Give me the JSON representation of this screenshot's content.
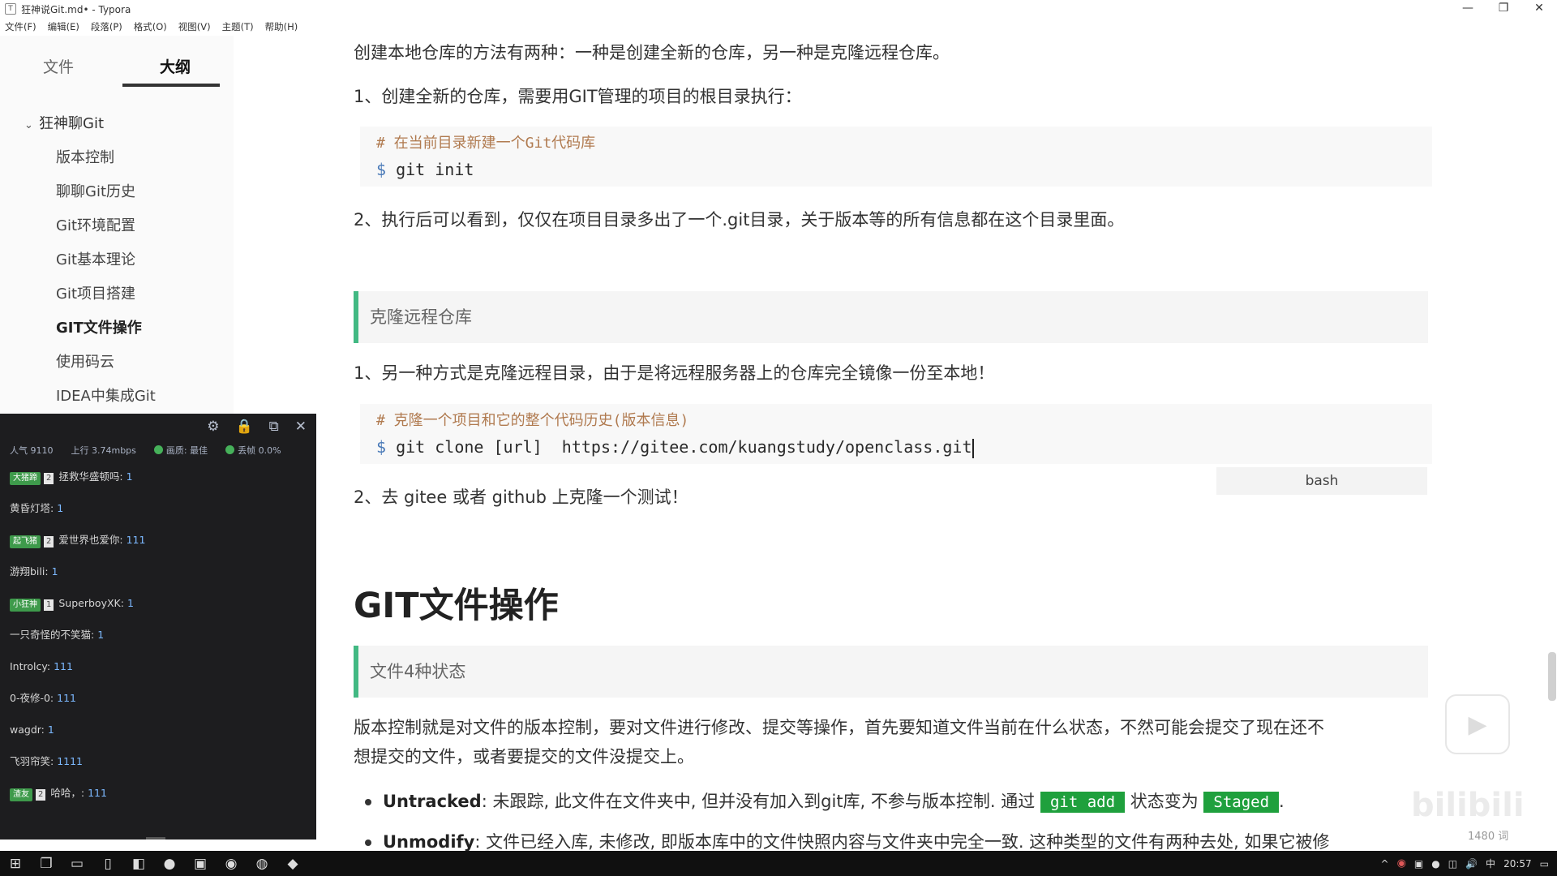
{
  "window": {
    "title": "狂神说Git.md• - Typora",
    "controls": [
      "—",
      "❐",
      "✕"
    ]
  },
  "menu": [
    "文件(F)",
    "编辑(E)",
    "段落(P)",
    "格式(O)",
    "视图(V)",
    "主题(T)",
    "帮助(H)"
  ],
  "sidebar": {
    "tabs": [
      {
        "label": "文件"
      },
      {
        "label": "大纲"
      }
    ],
    "outline_root": "狂神聊Git",
    "outline_items": [
      {
        "label": "版本控制"
      },
      {
        "label": "聊聊Git历史"
      },
      {
        "label": "Git环境配置"
      },
      {
        "label": "Git基本理论"
      },
      {
        "label": "Git项目搭建"
      },
      {
        "label": "GIT文件操作"
      },
      {
        "label": "使用码云"
      },
      {
        "label": "IDEA中集成Git"
      }
    ]
  },
  "chat": {
    "stats": {
      "popularity": "人气 9110",
      "upload": "上行 3.74mbps",
      "quality": "画质: 最佳",
      "loss": "丢帧 0.0%"
    },
    "messages": [
      {
        "badge": "大猪蹄",
        "level": "2",
        "user": "拯救华盛顿吗:",
        "text": "1"
      },
      {
        "badge": "",
        "level": "",
        "user": "黄昏灯塔:",
        "text": "1"
      },
      {
        "badge": "起飞猪",
        "level": "2",
        "user": "爱世界也爱你:",
        "text": "111"
      },
      {
        "badge": "",
        "level": "",
        "user": "游翔bili:",
        "text": "1"
      },
      {
        "badge": "小狂神",
        "level": "1",
        "user": "SuperboyXK:",
        "text": "1"
      },
      {
        "badge": "",
        "level": "",
        "user": "一只奇怪的不笑猫:",
        "text": "1"
      },
      {
        "badge": "",
        "level": "",
        "user": "Introlcy:",
        "text": "111"
      },
      {
        "badge": "",
        "level": "",
        "user": "0-夜修-0:",
        "text": "111"
      },
      {
        "badge": "",
        "level": "",
        "user": "wagdr:",
        "text": "1"
      },
      {
        "badge": "",
        "level": "",
        "user": "飞羽帘笑:",
        "text": "1111"
      },
      {
        "badge": "渣友",
        "level": "2",
        "user": "哈哈，:",
        "text": "111"
      }
    ]
  },
  "doc": {
    "p1": "创建本地仓库的方法有两种：一种是创建全新的仓库，另一种是克隆远程仓库。",
    "p2": "1、创建全新的仓库，需要用GIT管理的项目的根目录执行：",
    "code1_comment": "# 在当前目录新建一个Git代码库",
    "code1_cmd": "git init",
    "p3": "2、执行后可以看到，仅仅在项目目录多出了一个.git目录，关于版本等的所有信息都在这个目录里面。",
    "quote1": "克隆远程仓库",
    "p4": "1、另一种方式是克隆远程目录，由于是将远程服务器上的仓库完全镜像一份至本地！",
    "code2_comment": "# 克隆一个项目和它的整个代码历史(版本信息)",
    "code2_cmd": "git clone [url]  https://gitee.com/kuangstudy/openclass.git",
    "code2_lang": "bash",
    "p5": "2、去 gitee 或者 github 上克隆一个测试！",
    "h1": "GIT文件操作",
    "quote2": "文件4种状态",
    "p6a": "版本控制就是对文件的版本控制，要对文件进行修改、提交等操作，首先要知道文件当前在什么状态，不然可能会提交了现在还不",
    "p6b": "想提交的文件，或者要提交的文件没提交上。",
    "b1_term": "Untracked",
    "b1_text": ": 未跟踪, 此文件在文件夹中, 但并没有加入到git库, 不参与版本控制. 通过",
    "b1_code1": "git add",
    "b1_mid": "状态变为",
    "b1_code2": "Staged",
    "b1_end": ".",
    "b2_term": "Unmodify",
    "b2_text": ": 文件已经入库, 未修改, 即版本库中的文件快照内容与文件夹中完全一致. 这种类型的文件有两种去处, 如果它被修"
  },
  "status": {
    "wordcount": "1480 词",
    "watermark": "bilibili"
  },
  "taskbar": {
    "clock": "20:57",
    "ime": "中"
  }
}
